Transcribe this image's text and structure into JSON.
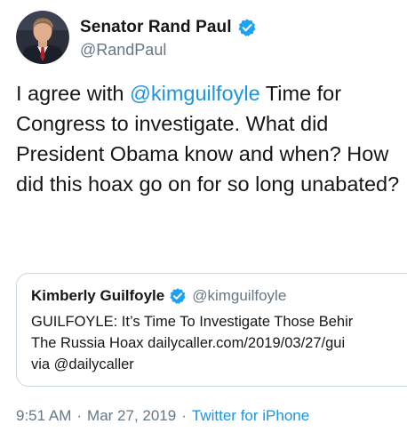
{
  "tweet": {
    "author": {
      "display_name": "Senator Rand Paul",
      "handle": "@RandPaul",
      "avatar_icon": "portrait-avatar",
      "verified_icon": "verified-badge-icon"
    },
    "text_parts": {
      "before_mention": "I agree with ",
      "mention": "@kimguilfoyle",
      "after_mention": " Time for Congress to investigate. What did President Obama know and when? How did this hoax go on for so long unabated?"
    },
    "quoted": {
      "display_name": "Kimberly Guilfoyle",
      "handle": "@kimguilfoyle",
      "verified_icon": "verified-badge-icon",
      "lines": [
        "GUILFOYLE: It’s Time To Investigate Those Behir",
        "The Russia Hoax dailycaller.com/2019/03/27/gui",
        "via @dailycaller"
      ]
    },
    "meta": {
      "time": "9:51 AM",
      "separator_1": "·",
      "date": "Mar 27, 2019",
      "separator_2": "·",
      "source": "Twitter for iPhone"
    }
  },
  "colors": {
    "link_blue": "#1b95e0",
    "text_primary": "#14171a",
    "text_secondary": "#657786",
    "border": "#ccd6dd"
  }
}
